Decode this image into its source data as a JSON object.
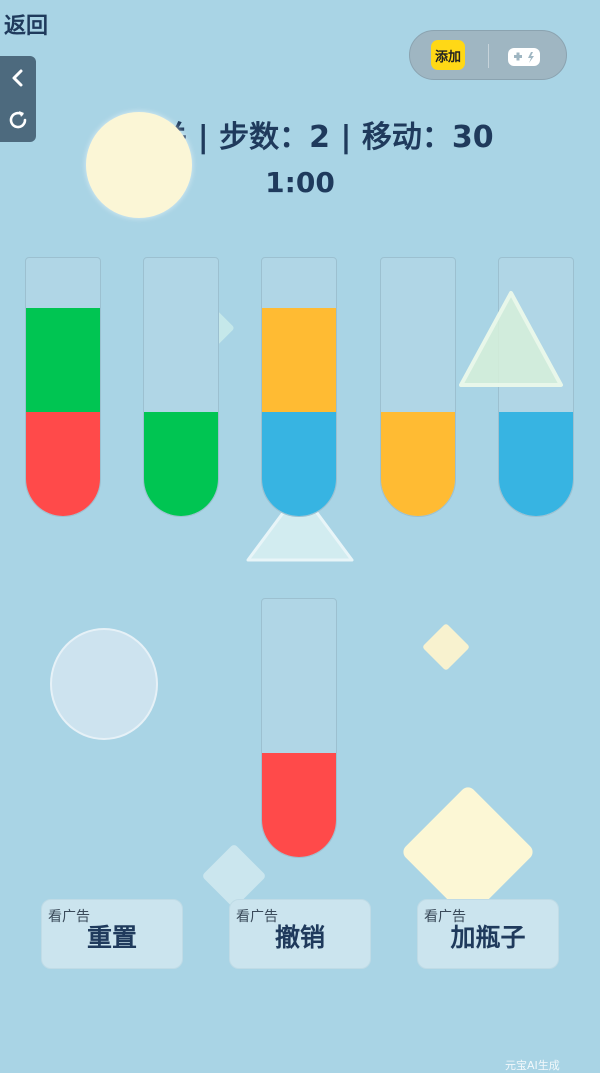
{
  "header": {
    "back_label": "返回",
    "add_label": "添加",
    "side_icons": [
      "chevron-left-icon",
      "refresh-icon"
    ],
    "capsule_icon": "gamepad-icon"
  },
  "status": {
    "text": "第5关 | 步数：2 | 移动：30",
    "timer": "1:00"
  },
  "colors": {
    "red": "#ff4a4a",
    "green": "#00c552",
    "orange": "#ffbb33",
    "blue": "#37b4e2"
  },
  "tubes": [
    {
      "layers_bottom_to_top": [
        "red",
        "green"
      ]
    },
    {
      "layers_bottom_to_top": [
        "green"
      ]
    },
    {
      "layers_bottom_to_top": [
        "blue",
        "orange"
      ]
    },
    {
      "layers_bottom_to_top": [
        "orange"
      ]
    },
    {
      "layers_bottom_to_top": [
        "blue"
      ]
    },
    {
      "layers_bottom_to_top": [
        "red"
      ]
    }
  ],
  "buttons": [
    {
      "tag": "看广告",
      "label": "重置"
    },
    {
      "tag": "看广告",
      "label": "撤销"
    },
    {
      "tag": "看广告",
      "label": "加瓶子"
    }
  ],
  "watermark": "元宝AI生成"
}
